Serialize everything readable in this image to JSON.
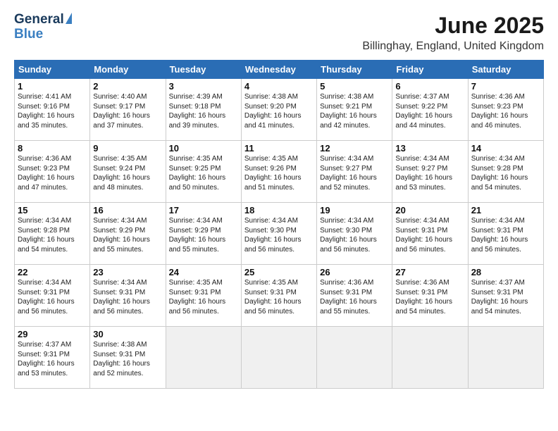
{
  "header": {
    "logo_general": "General",
    "logo_blue": "Blue",
    "title": "June 2025",
    "location": "Billinghay, England, United Kingdom"
  },
  "calendar": {
    "days_of_week": [
      "Sunday",
      "Monday",
      "Tuesday",
      "Wednesday",
      "Thursday",
      "Friday",
      "Saturday"
    ],
    "weeks": [
      [
        {
          "day": "1",
          "info": "Sunrise: 4:41 AM\nSunset: 9:16 PM\nDaylight: 16 hours\nand 35 minutes."
        },
        {
          "day": "2",
          "info": "Sunrise: 4:40 AM\nSunset: 9:17 PM\nDaylight: 16 hours\nand 37 minutes."
        },
        {
          "day": "3",
          "info": "Sunrise: 4:39 AM\nSunset: 9:18 PM\nDaylight: 16 hours\nand 39 minutes."
        },
        {
          "day": "4",
          "info": "Sunrise: 4:38 AM\nSunset: 9:20 PM\nDaylight: 16 hours\nand 41 minutes."
        },
        {
          "day": "5",
          "info": "Sunrise: 4:38 AM\nSunset: 9:21 PM\nDaylight: 16 hours\nand 42 minutes."
        },
        {
          "day": "6",
          "info": "Sunrise: 4:37 AM\nSunset: 9:22 PM\nDaylight: 16 hours\nand 44 minutes."
        },
        {
          "day": "7",
          "info": "Sunrise: 4:36 AM\nSunset: 9:23 PM\nDaylight: 16 hours\nand 46 minutes."
        }
      ],
      [
        {
          "day": "8",
          "info": "Sunrise: 4:36 AM\nSunset: 9:23 PM\nDaylight: 16 hours\nand 47 minutes."
        },
        {
          "day": "9",
          "info": "Sunrise: 4:35 AM\nSunset: 9:24 PM\nDaylight: 16 hours\nand 48 minutes."
        },
        {
          "day": "10",
          "info": "Sunrise: 4:35 AM\nSunset: 9:25 PM\nDaylight: 16 hours\nand 50 minutes."
        },
        {
          "day": "11",
          "info": "Sunrise: 4:35 AM\nSunset: 9:26 PM\nDaylight: 16 hours\nand 51 minutes."
        },
        {
          "day": "12",
          "info": "Sunrise: 4:34 AM\nSunset: 9:27 PM\nDaylight: 16 hours\nand 52 minutes."
        },
        {
          "day": "13",
          "info": "Sunrise: 4:34 AM\nSunset: 9:27 PM\nDaylight: 16 hours\nand 53 minutes."
        },
        {
          "day": "14",
          "info": "Sunrise: 4:34 AM\nSunset: 9:28 PM\nDaylight: 16 hours\nand 54 minutes."
        }
      ],
      [
        {
          "day": "15",
          "info": "Sunrise: 4:34 AM\nSunset: 9:28 PM\nDaylight: 16 hours\nand 54 minutes."
        },
        {
          "day": "16",
          "info": "Sunrise: 4:34 AM\nSunset: 9:29 PM\nDaylight: 16 hours\nand 55 minutes."
        },
        {
          "day": "17",
          "info": "Sunrise: 4:34 AM\nSunset: 9:29 PM\nDaylight: 16 hours\nand 55 minutes."
        },
        {
          "day": "18",
          "info": "Sunrise: 4:34 AM\nSunset: 9:30 PM\nDaylight: 16 hours\nand 56 minutes."
        },
        {
          "day": "19",
          "info": "Sunrise: 4:34 AM\nSunset: 9:30 PM\nDaylight: 16 hours\nand 56 minutes."
        },
        {
          "day": "20",
          "info": "Sunrise: 4:34 AM\nSunset: 9:31 PM\nDaylight: 16 hours\nand 56 minutes."
        },
        {
          "day": "21",
          "info": "Sunrise: 4:34 AM\nSunset: 9:31 PM\nDaylight: 16 hours\nand 56 minutes."
        }
      ],
      [
        {
          "day": "22",
          "info": "Sunrise: 4:34 AM\nSunset: 9:31 PM\nDaylight: 16 hours\nand 56 minutes."
        },
        {
          "day": "23",
          "info": "Sunrise: 4:34 AM\nSunset: 9:31 PM\nDaylight: 16 hours\nand 56 minutes."
        },
        {
          "day": "24",
          "info": "Sunrise: 4:35 AM\nSunset: 9:31 PM\nDaylight: 16 hours\nand 56 minutes."
        },
        {
          "day": "25",
          "info": "Sunrise: 4:35 AM\nSunset: 9:31 PM\nDaylight: 16 hours\nand 56 minutes."
        },
        {
          "day": "26",
          "info": "Sunrise: 4:36 AM\nSunset: 9:31 PM\nDaylight: 16 hours\nand 55 minutes."
        },
        {
          "day": "27",
          "info": "Sunrise: 4:36 AM\nSunset: 9:31 PM\nDaylight: 16 hours\nand 54 minutes."
        },
        {
          "day": "28",
          "info": "Sunrise: 4:37 AM\nSunset: 9:31 PM\nDaylight: 16 hours\nand 54 minutes."
        }
      ],
      [
        {
          "day": "29",
          "info": "Sunrise: 4:37 AM\nSunset: 9:31 PM\nDaylight: 16 hours\nand 53 minutes."
        },
        {
          "day": "30",
          "info": "Sunrise: 4:38 AM\nSunset: 9:31 PM\nDaylight: 16 hours\nand 52 minutes."
        },
        {
          "day": "",
          "info": ""
        },
        {
          "day": "",
          "info": ""
        },
        {
          "day": "",
          "info": ""
        },
        {
          "day": "",
          "info": ""
        },
        {
          "day": "",
          "info": ""
        }
      ]
    ]
  }
}
